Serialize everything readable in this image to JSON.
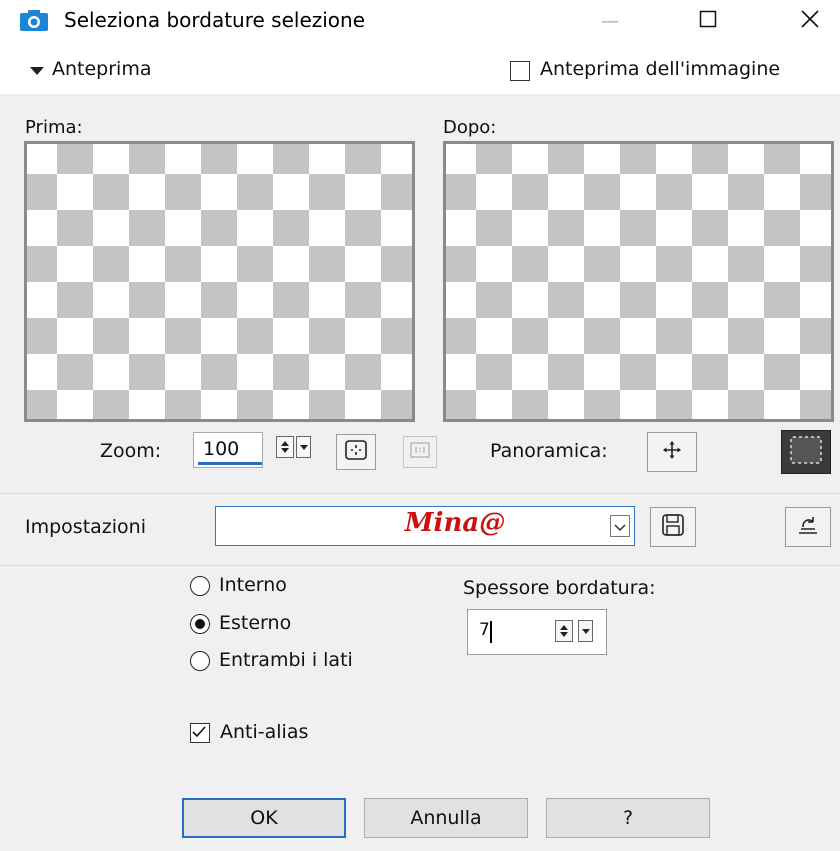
{
  "window": {
    "title": "Seleziona bordature selezione",
    "icon": "camera-icon",
    "minimize_glyph": "—",
    "maximize_glyph": "☐",
    "close_glyph": "✕"
  },
  "preview": {
    "section_label": "Anteprima",
    "image_preview_label": "Anteprima dell'immagine",
    "image_preview_checked": false,
    "before_label": "Prima:",
    "after_label": "Dopo:"
  },
  "zoom": {
    "label": "Zoom:",
    "value": "100",
    "pan_label": "Panoramica:"
  },
  "settings": {
    "label": "Impostazioni",
    "preset_value": "Mina@"
  },
  "options": {
    "radios": [
      {
        "label": "Interno",
        "selected": false
      },
      {
        "label": "Esterno",
        "selected": true
      },
      {
        "label": "Entrambi i lati",
        "selected": false
      }
    ],
    "thickness_label": "Spessore bordatura:",
    "thickness_value": "7",
    "antialias_label": "Anti-alias",
    "antialias_checked": true
  },
  "buttons": {
    "ok": "OK",
    "cancel": "Annulla",
    "help": "?"
  },
  "colors": {
    "accent": "#2a6cc2",
    "preset_text": "#cc1010",
    "checker_gray": "#c4c4c4"
  }
}
